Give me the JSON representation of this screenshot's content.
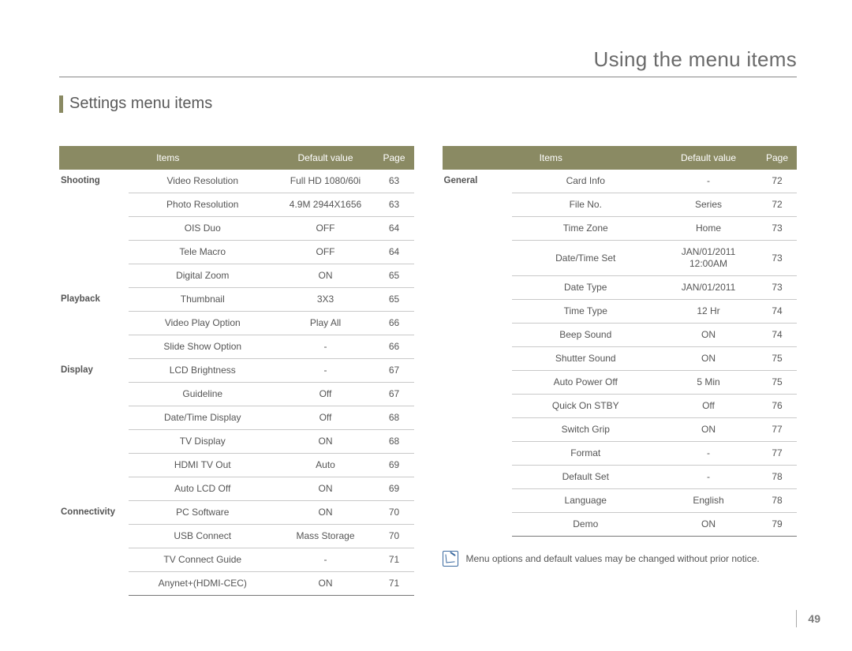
{
  "page_title": "Using the menu items",
  "section_title": "Settings menu items",
  "page_number": "49",
  "headers": {
    "items": "Items",
    "default": "Default value",
    "page": "Page"
  },
  "note": {
    "text": "Menu options and default values may be changed without prior notice."
  },
  "left_table": [
    {
      "category": "Shooting",
      "item": "Video Resolution",
      "default": "Full HD  1080/60i",
      "page": "63"
    },
    {
      "category": "",
      "item": "Photo Resolution",
      "default": "4.9M  2944X1656",
      "page": "63"
    },
    {
      "category": "",
      "item": "OIS Duo",
      "default": "OFF",
      "page": "64"
    },
    {
      "category": "",
      "item": "Tele Macro",
      "default": "OFF",
      "page": "64"
    },
    {
      "category": "",
      "item": "Digital Zoom",
      "default": "ON",
      "page": "65"
    },
    {
      "category": "Playback",
      "item": "Thumbnail",
      "default": "3X3",
      "page": "65"
    },
    {
      "category": "",
      "item": "Video Play Option",
      "default": "Play All",
      "page": "66"
    },
    {
      "category": "",
      "item": "Slide Show Option",
      "default": "-",
      "page": "66"
    },
    {
      "category": "Display",
      "item": "LCD Brightness",
      "default": "-",
      "page": "67"
    },
    {
      "category": "",
      "item": "Guideline",
      "default": "Off",
      "page": "67"
    },
    {
      "category": "",
      "item": "Date/Time Display",
      "default": "Off",
      "page": "68"
    },
    {
      "category": "",
      "item": "TV Display",
      "default": "ON",
      "page": "68"
    },
    {
      "category": "",
      "item": "HDMI TV Out",
      "default": "Auto",
      "page": "69"
    },
    {
      "category": "",
      "item": "Auto LCD Off",
      "default": "ON",
      "page": "69"
    },
    {
      "category": "Connectivity",
      "item": "PC Software",
      "default": "ON",
      "page": "70"
    },
    {
      "category": "",
      "item": "USB Connect",
      "default": "Mass Storage",
      "page": "70"
    },
    {
      "category": "",
      "item": "TV Connect Guide",
      "default": "-",
      "page": "71"
    },
    {
      "category": "",
      "item": "Anynet+(HDMI-CEC)",
      "default": "ON",
      "page": "71"
    }
  ],
  "right_table": [
    {
      "category": "General",
      "item": "Card Info",
      "default": "-",
      "page": "72"
    },
    {
      "category": "",
      "item": "File No.",
      "default": "Series",
      "page": "72"
    },
    {
      "category": "",
      "item": "Time Zone",
      "default": "Home",
      "page": "73"
    },
    {
      "category": "",
      "item": "Date/Time Set",
      "default": "JAN/01/2011\n12:00AM",
      "page": "73"
    },
    {
      "category": "",
      "item": "Date Type",
      "default": "JAN/01/2011",
      "page": "73"
    },
    {
      "category": "",
      "item": "Time Type",
      "default": "12 Hr",
      "page": "74"
    },
    {
      "category": "",
      "item": "Beep Sound",
      "default": "ON",
      "page": "74"
    },
    {
      "category": "",
      "item": "Shutter Sound",
      "default": "ON",
      "page": "75"
    },
    {
      "category": "",
      "item": "Auto Power Off",
      "default": "5 Min",
      "page": "75"
    },
    {
      "category": "",
      "item": "Quick On STBY",
      "default": "Off",
      "page": "76"
    },
    {
      "category": "",
      "item": "Switch Grip",
      "default": "ON",
      "page": "77"
    },
    {
      "category": "",
      "item": "Format",
      "default": "-",
      "page": "77"
    },
    {
      "category": "",
      "item": "Default Set",
      "default": "-",
      "page": "78"
    },
    {
      "category": "",
      "item": "Language",
      "default": "English",
      "page": "78"
    },
    {
      "category": "",
      "item": "Demo",
      "default": "ON",
      "page": "79"
    }
  ]
}
